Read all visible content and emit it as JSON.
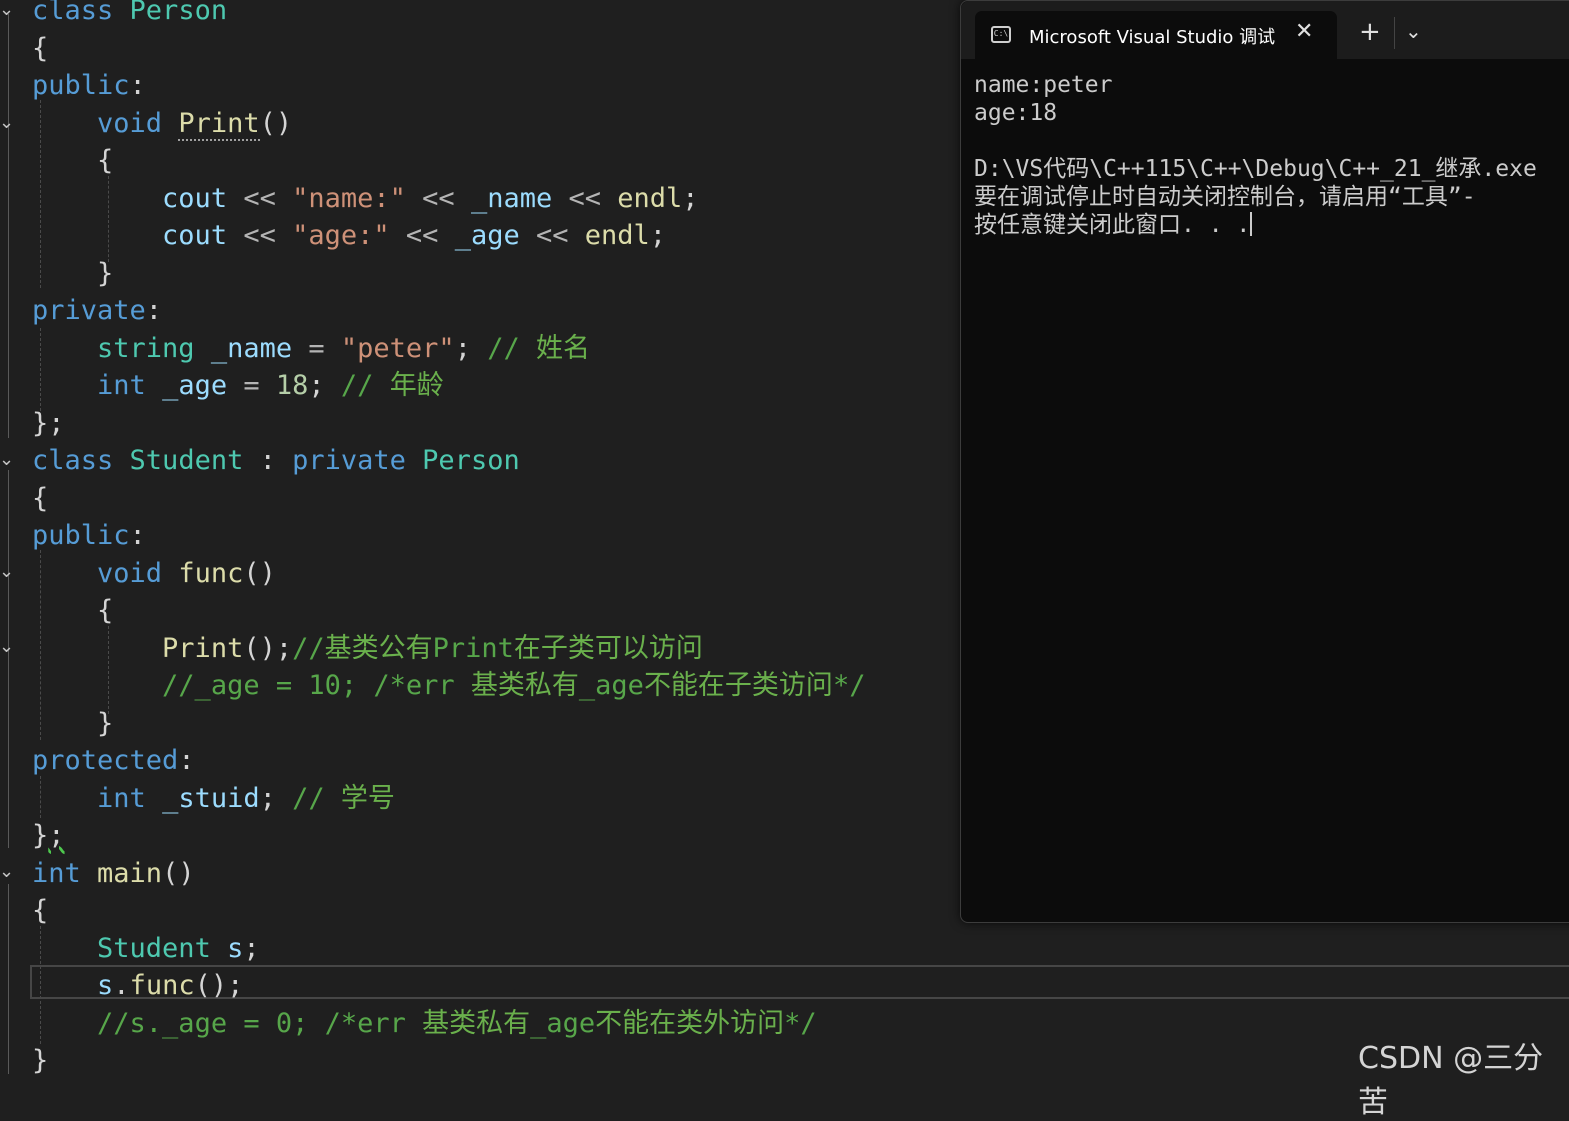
{
  "editor": {
    "lines": [
      {
        "segs": [
          {
            "t": "class ",
            "c": "kw"
          },
          {
            "t": "Person",
            "c": "ty"
          }
        ]
      },
      {
        "segs": [
          {
            "t": "{",
            "c": "pun"
          }
        ]
      },
      {
        "segs": [
          {
            "t": "public",
            "c": "kw"
          },
          {
            "t": ":",
            "c": "pun"
          }
        ]
      },
      {
        "segs": [
          {
            "t": "    ",
            "c": "pun"
          },
          {
            "t": "void ",
            "c": "kw"
          },
          {
            "t": "Print",
            "c": "fn dotted"
          },
          {
            "t": "()",
            "c": "pun"
          }
        ]
      },
      {
        "segs": [
          {
            "t": "    {",
            "c": "pun"
          }
        ]
      },
      {
        "segs": [
          {
            "t": "        ",
            "c": "pun"
          },
          {
            "t": "cout",
            "c": "var"
          },
          {
            "t": " << ",
            "c": "op"
          },
          {
            "t": "\"name:\"",
            "c": "str"
          },
          {
            "t": " << ",
            "c": "op"
          },
          {
            "t": "_name",
            "c": "var"
          },
          {
            "t": " << ",
            "c": "op"
          },
          {
            "t": "endl",
            "c": "fn"
          },
          {
            "t": ";",
            "c": "pun"
          }
        ]
      },
      {
        "segs": [
          {
            "t": "        ",
            "c": "pun"
          },
          {
            "t": "cout",
            "c": "var"
          },
          {
            "t": " << ",
            "c": "op"
          },
          {
            "t": "\"age:\"",
            "c": "str"
          },
          {
            "t": " << ",
            "c": "op"
          },
          {
            "t": "_age",
            "c": "var"
          },
          {
            "t": " << ",
            "c": "op"
          },
          {
            "t": "endl",
            "c": "fn"
          },
          {
            "t": ";",
            "c": "pun"
          }
        ]
      },
      {
        "segs": [
          {
            "t": "    }",
            "c": "pun"
          }
        ]
      },
      {
        "segs": [
          {
            "t": "private",
            "c": "kw"
          },
          {
            "t": ":",
            "c": "pun"
          }
        ]
      },
      {
        "segs": [
          {
            "t": "    ",
            "c": "pun"
          },
          {
            "t": "string ",
            "c": "ty"
          },
          {
            "t": "_name",
            "c": "var"
          },
          {
            "t": " = ",
            "c": "op"
          },
          {
            "t": "\"peter\"",
            "c": "str"
          },
          {
            "t": "; ",
            "c": "pun"
          },
          {
            "t": "// ",
            "c": "cm"
          },
          {
            "t": "姓名",
            "c": "cmz"
          }
        ]
      },
      {
        "segs": [
          {
            "t": "    ",
            "c": "pun"
          },
          {
            "t": "int ",
            "c": "kw"
          },
          {
            "t": "_age",
            "c": "var"
          },
          {
            "t": " = ",
            "c": "op"
          },
          {
            "t": "18",
            "c": "num"
          },
          {
            "t": "; ",
            "c": "pun"
          },
          {
            "t": "// ",
            "c": "cm"
          },
          {
            "t": "年龄",
            "c": "cmz"
          }
        ]
      },
      {
        "segs": [
          {
            "t": "};",
            "c": "pun"
          }
        ]
      },
      {
        "segs": [
          {
            "t": "class ",
            "c": "kw"
          },
          {
            "t": "Student",
            "c": "ty"
          },
          {
            "t": " : ",
            "c": "pun"
          },
          {
            "t": "private ",
            "c": "kw"
          },
          {
            "t": "Person",
            "c": "ty"
          }
        ]
      },
      {
        "segs": [
          {
            "t": "{",
            "c": "pun"
          }
        ]
      },
      {
        "segs": [
          {
            "t": "public",
            "c": "kw"
          },
          {
            "t": ":",
            "c": "pun"
          }
        ]
      },
      {
        "segs": [
          {
            "t": "    ",
            "c": "pun"
          },
          {
            "t": "void ",
            "c": "kw"
          },
          {
            "t": "func",
            "c": "fn"
          },
          {
            "t": "()",
            "c": "pun"
          }
        ]
      },
      {
        "segs": [
          {
            "t": "    {",
            "c": "pun"
          }
        ]
      },
      {
        "segs": [
          {
            "t": "        ",
            "c": "pun"
          },
          {
            "t": "Print",
            "c": "fn"
          },
          {
            "t": "();",
            "c": "pun"
          },
          {
            "t": "//",
            "c": "cm"
          },
          {
            "t": "基类公有",
            "c": "cmz"
          },
          {
            "t": "Print",
            "c": "cm"
          },
          {
            "t": "在子类可以访问",
            "c": "cmz"
          }
        ]
      },
      {
        "segs": [
          {
            "t": "        ",
            "c": "pun"
          },
          {
            "t": "//_age = 10; /*err ",
            "c": "cm"
          },
          {
            "t": "基类私有",
            "c": "cmz"
          },
          {
            "t": "_age",
            "c": "cm"
          },
          {
            "t": "不能在子类访问",
            "c": "cmz"
          },
          {
            "t": "*/",
            "c": "cm"
          }
        ]
      },
      {
        "segs": [
          {
            "t": "    }",
            "c": "pun"
          }
        ]
      },
      {
        "segs": [
          {
            "t": "protected",
            "c": "kw"
          },
          {
            "t": ":",
            "c": "pun"
          }
        ]
      },
      {
        "segs": [
          {
            "t": "    ",
            "c": "pun"
          },
          {
            "t": "int ",
            "c": "kw"
          },
          {
            "t": "_stuid",
            "c": "var"
          },
          {
            "t": "; ",
            "c": "pun"
          },
          {
            "t": "// ",
            "c": "cm"
          },
          {
            "t": "学号",
            "c": "cmz"
          }
        ]
      },
      {
        "segs": [
          {
            "t": "}",
            "c": "pun"
          },
          {
            "t": ";",
            "c": "pun squig"
          }
        ]
      },
      {
        "segs": [
          {
            "t": "int ",
            "c": "kw"
          },
          {
            "t": "main",
            "c": "fn"
          },
          {
            "t": "()",
            "c": "pun"
          }
        ]
      },
      {
        "segs": [
          {
            "t": "{",
            "c": "pun"
          }
        ]
      },
      {
        "segs": [
          {
            "t": "    ",
            "c": "pun"
          },
          {
            "t": "Student ",
            "c": "ty"
          },
          {
            "t": "s",
            "c": "var"
          },
          {
            "t": ";",
            "c": "pun"
          }
        ]
      },
      {
        "segs": [
          {
            "t": "    ",
            "c": "pun"
          },
          {
            "t": "s",
            "c": "var"
          },
          {
            "t": ".",
            "c": "pun"
          },
          {
            "t": "func",
            "c": "fn"
          },
          {
            "t": "();",
            "c": "pun"
          }
        ]
      },
      {
        "segs": [
          {
            "t": "    ",
            "c": "pun"
          },
          {
            "t": "//s._age = 0; /*err ",
            "c": "cm"
          },
          {
            "t": "基类私有",
            "c": "cmz"
          },
          {
            "t": "_age",
            "c": "cm"
          },
          {
            "t": "不能在类外访问",
            "c": "cmz"
          },
          {
            "t": "*/",
            "c": "cm"
          }
        ]
      },
      {
        "segs": [
          {
            "t": "}",
            "c": "pun"
          }
        ]
      }
    ]
  },
  "terminal": {
    "tab_title": "Microsoft Visual Studio 调试控",
    "tab_icon_text": "C:\\",
    "close_glyph": "✕",
    "new_tab_glyph": "+",
    "dropdown_glyph": "⌄",
    "output": [
      "name:peter",
      "age:18",
      "",
      "D:\\VS代码\\C++115\\C++\\Debug\\C++_21_继承.exe",
      "要在调试停止时自动关闭控制台，请启用“工具”-",
      "按任意键关闭此窗口. . ."
    ]
  },
  "watermark": "CSDN @三分苦",
  "colors": {
    "keyword": "#569cd6",
    "type": "#4ec9b0",
    "function": "#dcdcaa",
    "string": "#ce9178",
    "number": "#b5cea8",
    "comment": "#57a64a",
    "variable": "#9cdcfe",
    "background": "#1f1f1f"
  }
}
